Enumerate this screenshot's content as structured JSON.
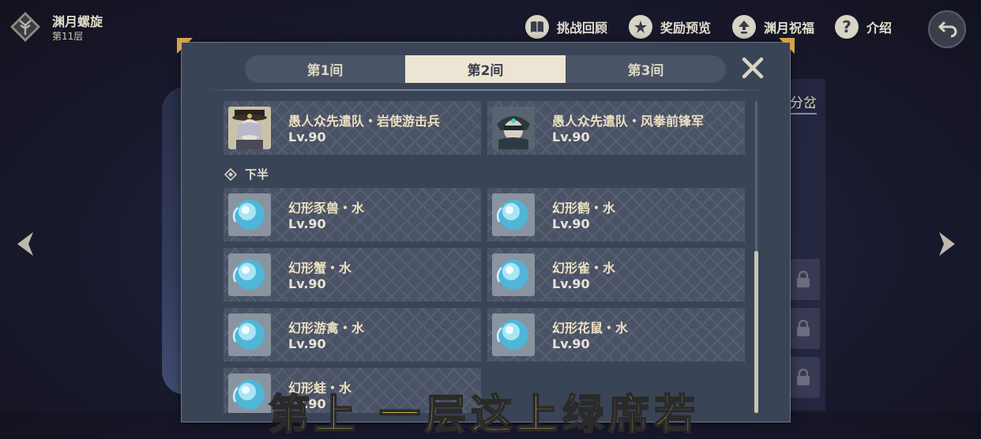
{
  "header": {
    "title": "渊月螺旋",
    "floor": "第11层"
  },
  "topnav": [
    {
      "label": "挑战回顾",
      "icon": "book-icon"
    },
    {
      "label": "奖励预览",
      "icon": "star-badge-icon"
    },
    {
      "label": "渊月祝福",
      "icon": "upgrade-arrow-icon"
    },
    {
      "label": "介绍",
      "icon": "help-icon"
    }
  ],
  "tabs": [
    {
      "label": "第1间",
      "active": false
    },
    {
      "label": "第2间",
      "active": true
    },
    {
      "label": "第3间",
      "active": false
    }
  ],
  "background": {
    "right_text": "分岔"
  },
  "top_half_enemies": [
    {
      "name": "愚人众先遣队・岩使游击兵",
      "level": "Lv.90",
      "portrait": "rock-skirmisher"
    },
    {
      "name": "愚人众先遣队・风拳前锋军",
      "level": "Lv.90",
      "portrait": "anemo-vanguard"
    }
  ],
  "lower_half": {
    "label": "下半",
    "enemies": [
      {
        "name": "幻形豕兽・水",
        "level": "Lv.90",
        "portrait": "hydro-mimic"
      },
      {
        "name": "幻形鹤・水",
        "level": "Lv.90",
        "portrait": "hydro-mimic"
      },
      {
        "name": "幻形蟹・水",
        "level": "Lv.90",
        "portrait": "hydro-mimic"
      },
      {
        "name": "幻形雀・水",
        "level": "Lv.90",
        "portrait": "hydro-mimic"
      },
      {
        "name": "幻形游禽・水",
        "level": "Lv.90",
        "portrait": "hydro-mimic"
      },
      {
        "name": "幻形花鼠・水",
        "level": "Lv.90",
        "portrait": "hydro-mimic"
      },
      {
        "name": "幻形蛙・水",
        "level": "Lv.90",
        "portrait": "hydro-mimic"
      }
    ]
  },
  "overlay_caption": "第上 一层这上绿席若",
  "colors": {
    "panel": "#3a4457",
    "card": "#4a5266",
    "tab_active": "#ece5d3",
    "accent_gold": "#d6a24a",
    "caption": "#f7e65a"
  }
}
